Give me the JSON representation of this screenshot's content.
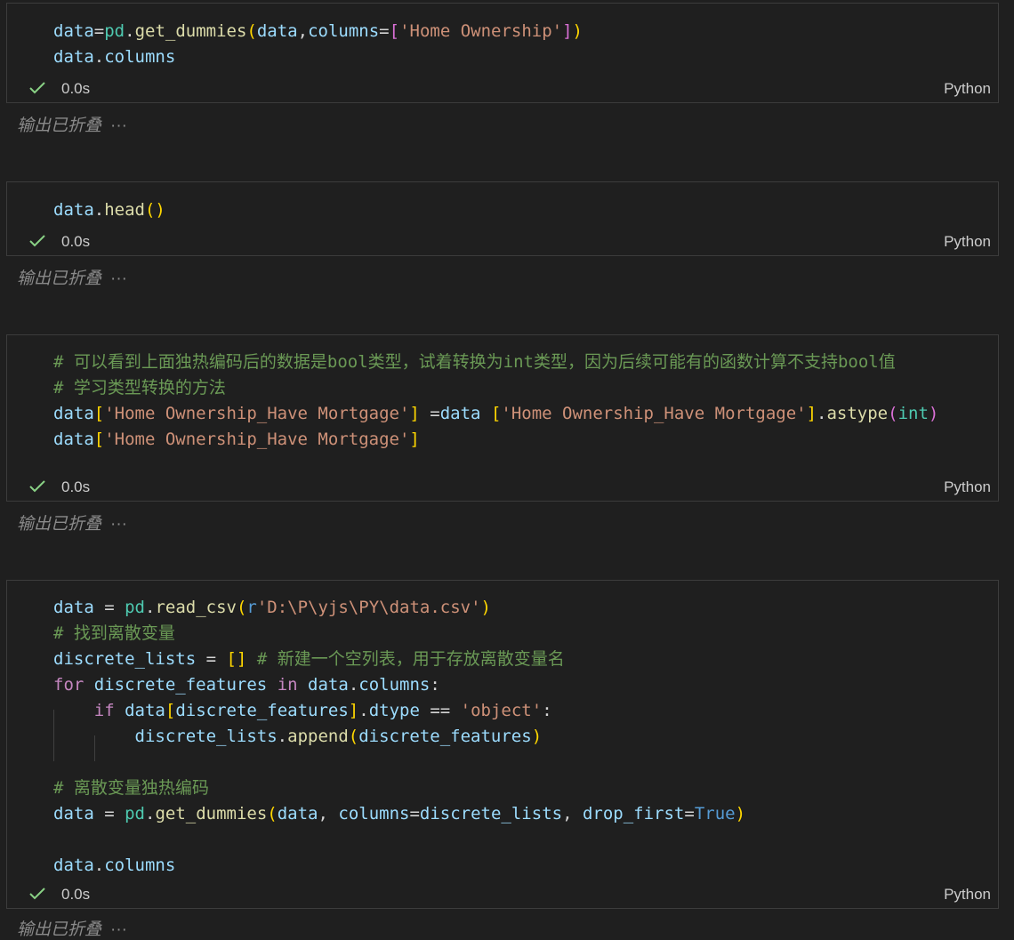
{
  "cells": [
    {
      "lines": [
        [
          [
            "v",
            "data"
          ],
          [
            "o",
            "="
          ],
          [
            "t",
            "pd"
          ],
          [
            "o",
            "."
          ],
          [
            "f",
            "get_dummies"
          ],
          [
            "p1",
            "("
          ],
          [
            "v",
            "data"
          ],
          [
            "o",
            ","
          ],
          [
            "v",
            "columns"
          ],
          [
            "o",
            "="
          ],
          [
            "p2",
            "["
          ],
          [
            "s",
            "'Home Ownership'"
          ],
          [
            "p2",
            "]"
          ],
          [
            "p1",
            ")"
          ]
        ],
        [
          [
            "v",
            "data"
          ],
          [
            "o",
            "."
          ],
          [
            "v",
            "columns"
          ]
        ]
      ],
      "status_time": "0.0s",
      "language": "Python",
      "collapsed_text": "输出已折叠",
      "collapsed_dots": "···"
    },
    {
      "lines": [
        [
          [
            "v",
            "data"
          ],
          [
            "o",
            "."
          ],
          [
            "f",
            "head"
          ],
          [
            "p1",
            "()"
          ]
        ]
      ],
      "status_time": "0.0s",
      "language": "Python",
      "collapsed_text": "输出已折叠",
      "collapsed_dots": "···"
    },
    {
      "lines": [
        [
          [
            "c",
            "# 可以看到上面独热编码后的数据是bool类型，试着转换为int类型，因为后续可能有的函数计算不支持bool值"
          ]
        ],
        [
          [
            "c",
            "# 学习类型转换的方法"
          ]
        ],
        [
          [
            "v",
            "data"
          ],
          [
            "p1",
            "["
          ],
          [
            "s",
            "'Home Ownership_Have Mortgage'"
          ],
          [
            "p1",
            "]"
          ],
          [
            "o",
            " ="
          ],
          [
            "v",
            "data"
          ],
          [
            "o",
            " "
          ],
          [
            "p1",
            "["
          ],
          [
            "s",
            "'Home Ownership_Have Mortgage'"
          ],
          [
            "p1",
            "]"
          ],
          [
            "o",
            "."
          ],
          [
            "f",
            "astype"
          ],
          [
            "p2",
            "("
          ],
          [
            "t",
            "int"
          ],
          [
            "p2",
            ")"
          ]
        ],
        [
          [
            "v",
            "data"
          ],
          [
            "p1",
            "["
          ],
          [
            "s",
            "'Home Ownership_Have Mortgage'"
          ],
          [
            "p1",
            "]"
          ]
        ]
      ],
      "status_time": "0.0s",
      "language": "Python",
      "collapsed_text": "输出已折叠",
      "collapsed_dots": "···"
    },
    {
      "lines": [
        [
          [
            "v",
            "data"
          ],
          [
            "o",
            " = "
          ],
          [
            "t",
            "pd"
          ],
          [
            "o",
            "."
          ],
          [
            "f",
            "read_csv"
          ],
          [
            "p1",
            "("
          ],
          [
            "b",
            "r"
          ],
          [
            "s",
            "'D:\\P\\yjs\\PY\\data.csv'"
          ],
          [
            "p1",
            ")"
          ]
        ],
        [
          [
            "c",
            "# 找到离散变量"
          ]
        ],
        [
          [
            "v",
            "discrete_lists"
          ],
          [
            "o",
            " = "
          ],
          [
            "p1",
            "[]"
          ],
          [
            "o",
            " "
          ],
          [
            "c",
            "# 新建一个空列表，用于存放离散变量名"
          ]
        ],
        [
          [
            "k",
            "for"
          ],
          [
            "o",
            " "
          ],
          [
            "v",
            "discrete_features"
          ],
          [
            "o",
            " "
          ],
          [
            "k",
            "in"
          ],
          [
            "o",
            " "
          ],
          [
            "v",
            "data"
          ],
          [
            "o",
            "."
          ],
          [
            "v",
            "columns"
          ],
          [
            "o",
            ":"
          ]
        ],
        [
          [
            "o",
            "    "
          ],
          [
            "k",
            "if"
          ],
          [
            "o",
            " "
          ],
          [
            "v",
            "data"
          ],
          [
            "p1",
            "["
          ],
          [
            "v",
            "discrete_features"
          ],
          [
            "p1",
            "]"
          ],
          [
            "o",
            "."
          ],
          [
            "v",
            "dtype"
          ],
          [
            "o",
            " == "
          ],
          [
            "s",
            "'object'"
          ],
          [
            "o",
            ":"
          ]
        ],
        [
          [
            "o",
            "        "
          ],
          [
            "v",
            "discrete_lists"
          ],
          [
            "o",
            "."
          ],
          [
            "f",
            "append"
          ],
          [
            "p1",
            "("
          ],
          [
            "v",
            "discrete_features"
          ],
          [
            "p1",
            ")"
          ]
        ],
        [],
        [
          [
            "c",
            "# 离散变量独热编码"
          ]
        ],
        [
          [
            "v",
            "data"
          ],
          [
            "o",
            " = "
          ],
          [
            "t",
            "pd"
          ],
          [
            "o",
            "."
          ],
          [
            "f",
            "get_dummies"
          ],
          [
            "p1",
            "("
          ],
          [
            "v",
            "data"
          ],
          [
            "o",
            ", "
          ],
          [
            "v",
            "columns"
          ],
          [
            "o",
            "="
          ],
          [
            "v",
            "discrete_lists"
          ],
          [
            "o",
            ", "
          ],
          [
            "v",
            "drop_first"
          ],
          [
            "o",
            "="
          ],
          [
            "b",
            "True"
          ],
          [
            "p1",
            ")"
          ]
        ],
        [],
        [
          [
            "v",
            "data"
          ],
          [
            "o",
            "."
          ],
          [
            "v",
            "columns"
          ]
        ]
      ],
      "status_time": "0.0s",
      "language": "Python",
      "collapsed_text": "输出已折叠",
      "collapsed_dots": "···"
    }
  ]
}
